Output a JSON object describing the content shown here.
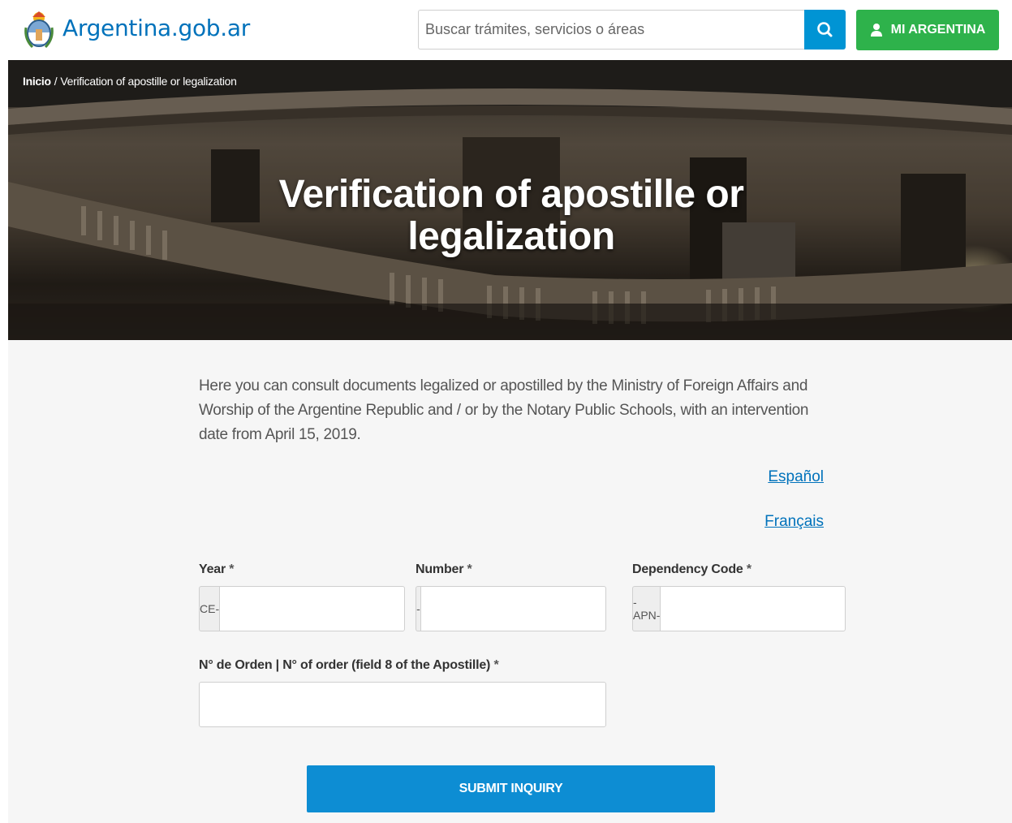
{
  "header": {
    "brand": "Argentina.gob.ar",
    "search_placeholder": "Buscar trámites, servicios o áreas",
    "mi_argentina_label": "MI ARGENTINA"
  },
  "breadcrumb": {
    "home": "Inicio",
    "separator": "/",
    "current": "Verification of apostille or legalization"
  },
  "hero": {
    "title": "Verification of apostille or legalization"
  },
  "main": {
    "intro": "Here you can consult documents legalized or apostilled by the Ministry of Foreign Affairs and Worship of the Argentine Republic and / or by the Notary Public Schools, with an intervention date from April 15, 2019.",
    "lang_es": "Español",
    "lang_fr": "Français",
    "fields": {
      "year": {
        "label": "Year",
        "required": "*",
        "prefix": "CE-",
        "value": ""
      },
      "number": {
        "label": "Number",
        "required": "*",
        "prefix": "-",
        "value": ""
      },
      "dependency": {
        "label": "Dependency Code",
        "required": "*",
        "prefix": "-APN-",
        "value": ""
      },
      "order": {
        "label": "N° de Orden | N° of order (field 8 of the Apostille)",
        "required": "*",
        "value": ""
      }
    },
    "submit_label": "SUBMIT INQUIRY"
  },
  "colors": {
    "brand_blue": "#0072bb",
    "search_button": "#0094d4",
    "mi_argentina_green": "#2eb24b",
    "submit_blue": "#0d8dd3"
  },
  "icons": {
    "search": "search-icon",
    "user": "user-icon",
    "coat_of_arms": "coat-of-arms-icon"
  }
}
